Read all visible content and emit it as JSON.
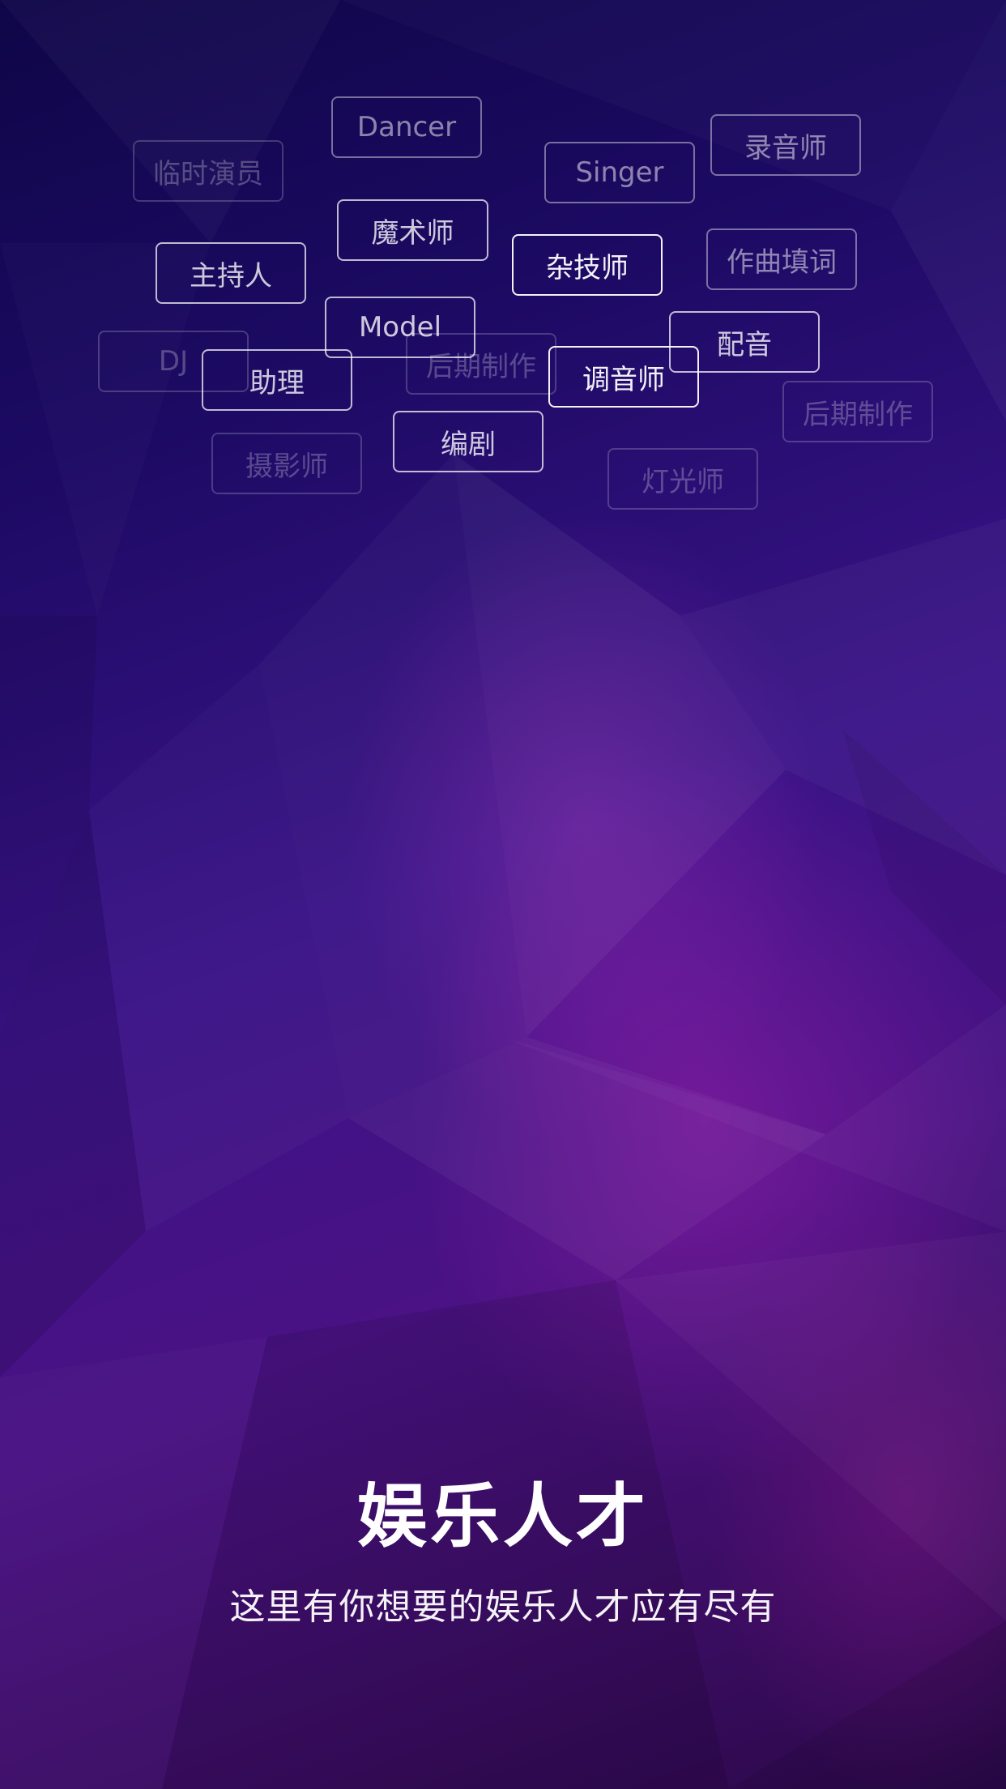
{
  "tags": {
    "dancer": "Dancer",
    "linshi_yanyuan": "临时演员",
    "singer": "Singer",
    "luyinshi": "录音师",
    "moshushi": "魔术师",
    "zhuchiren": "主持人",
    "zajishi": "杂技师",
    "zuoqu_tianci": "作曲填词",
    "dj": "DJ",
    "model": "Model",
    "houqi_zhizuo_1": "后期制作",
    "zhuli": "助理",
    "tiaoyinshi": "调音师",
    "peiyin": "配音",
    "houqi_zhizuo_2": "后期制作",
    "bianju": "编剧",
    "sheyingshi": "摄影师",
    "dengguangshi": "灯光师"
  },
  "hero": {
    "title": "娱乐人才",
    "subtitle": "这里有你想要的娱乐人才应有尽有"
  },
  "colors": {
    "background_top": "#0f0648",
    "background_mid": "#3a1387",
    "background_bottom": "#2a0848",
    "accent_magenta": "#9620aa",
    "text": "#ffffff"
  }
}
